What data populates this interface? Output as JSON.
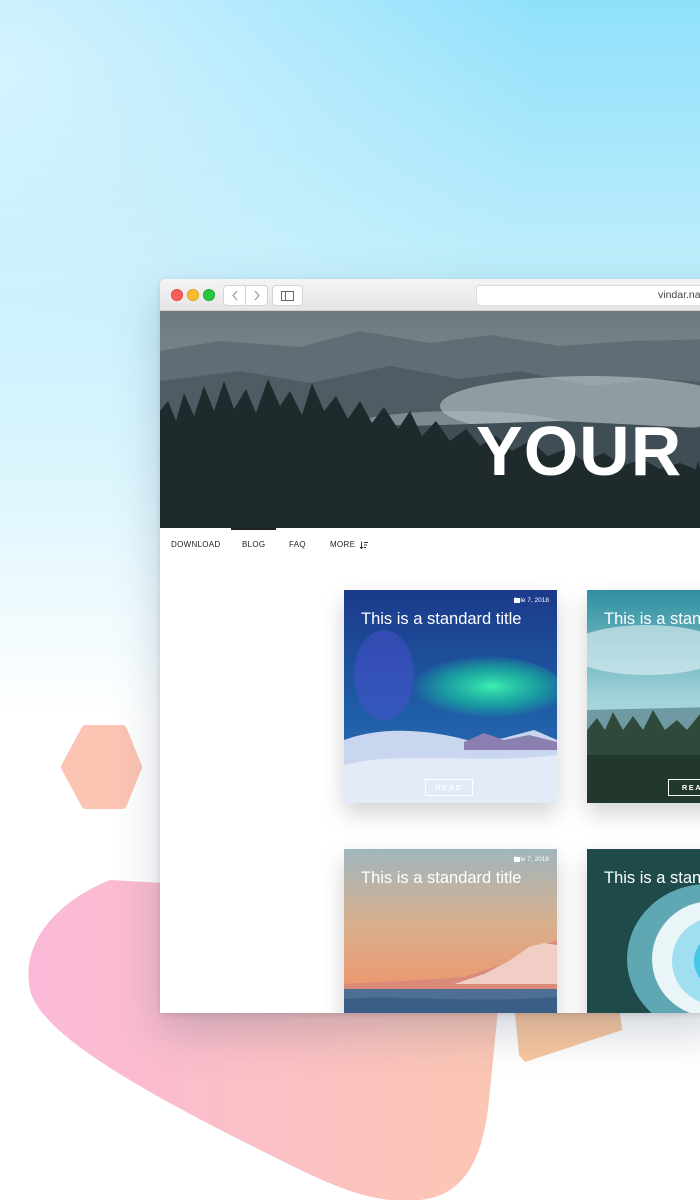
{
  "colors": {
    "background_top": "#8fe0fb",
    "decor_pink": "#fbb7d6",
    "decor_peach": "#fbc5a8",
    "decor_orange": "#f9c18c"
  },
  "browser": {
    "traffic_lights": [
      "close",
      "minimize",
      "zoom"
    ],
    "back_icon": "chevron-left-icon",
    "forward_icon": "chevron-right-icon",
    "sidebar_icon": "sidebar-icon",
    "address": "vindar.nam"
  },
  "hero": {
    "title": "YOUR"
  },
  "nav": {
    "items": [
      {
        "label": "DOWNLOAD"
      },
      {
        "label": "BLOG"
      },
      {
        "label": "FAQ"
      },
      {
        "label": "MORE",
        "icon": "sort-icon"
      }
    ],
    "active": "BLOG"
  },
  "cards": [
    {
      "date": "Jule 7, 2018",
      "title": "This is a standard title",
      "button": "READ",
      "theme": "aurora"
    },
    {
      "date": "",
      "title": "This is a stan",
      "button": "REA",
      "theme": "forest-lake"
    },
    {
      "date": "Jule 7, 2018",
      "title": "This is a standard title",
      "button": "",
      "theme": "sunset-mountain"
    },
    {
      "date": "",
      "title": "This is a stan",
      "button": "",
      "theme": "ocean-wave"
    }
  ]
}
